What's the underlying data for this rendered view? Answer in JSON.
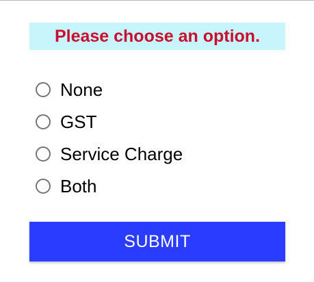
{
  "dialog": {
    "prompt": "Please choose an option.",
    "options": [
      {
        "label": "None",
        "selected": false
      },
      {
        "label": "GST",
        "selected": false
      },
      {
        "label": "Service Charge",
        "selected": false
      },
      {
        "label": "Both",
        "selected": false
      }
    ],
    "submit_label": "SUBMIT"
  },
  "colors": {
    "prompt_text": "#c8102e",
    "prompt_background": "#c8f4fb",
    "submit_background": "#2a3cff",
    "radio_border": "#757575"
  },
  "icons": {
    "radio": "radio-unchecked-icon"
  }
}
